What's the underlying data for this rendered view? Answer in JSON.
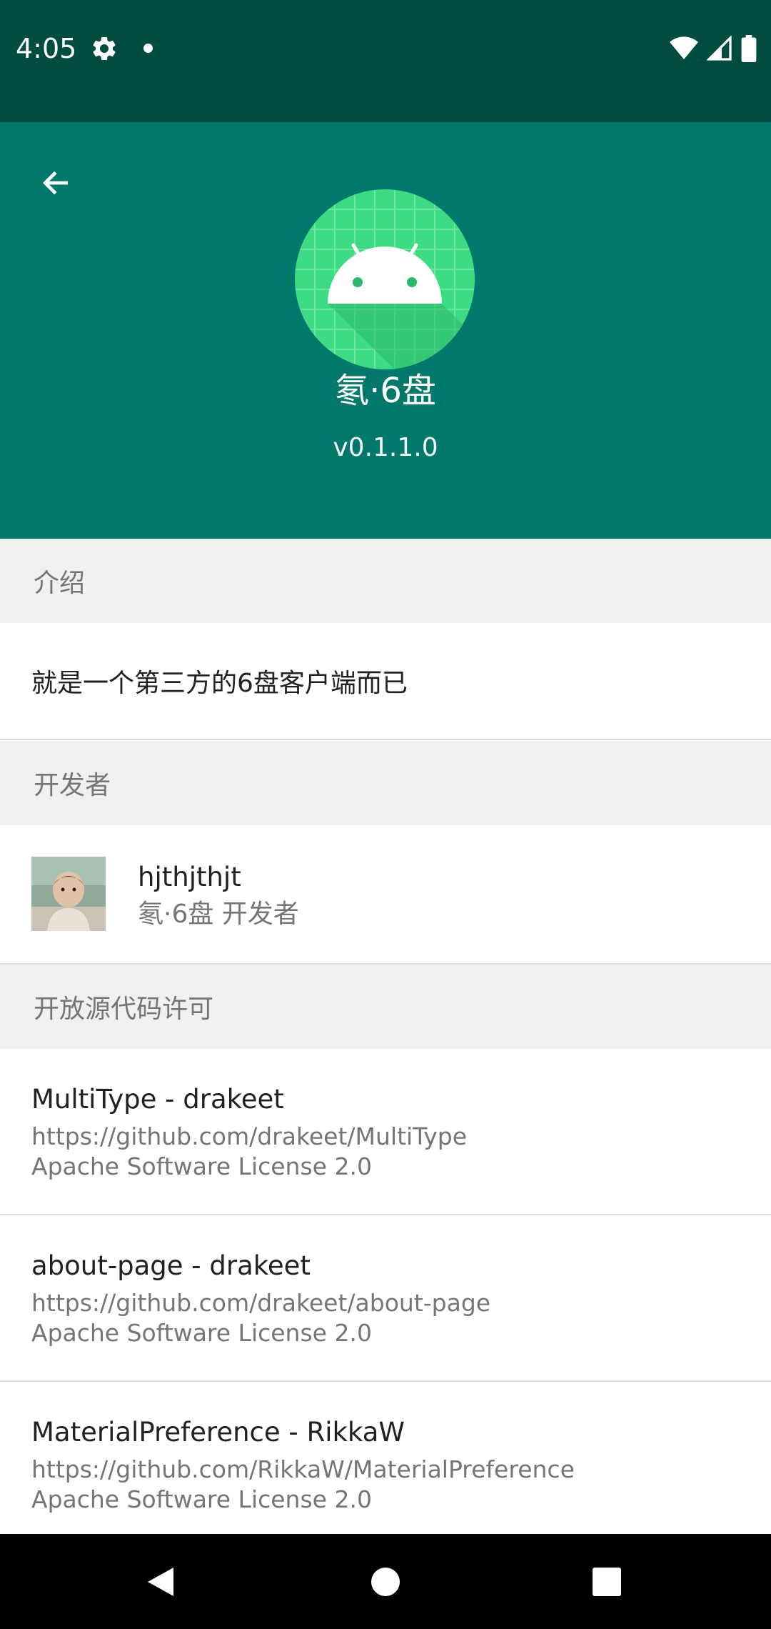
{
  "status_bar": {
    "time": "4:05",
    "icons": [
      "gear-icon",
      "notification-dot-icon",
      "wifi-icon",
      "cell-signal-icon",
      "battery-icon"
    ]
  },
  "header": {
    "back_icon": "arrow-left-icon",
    "app_icon": "android-robot-icon",
    "app_name": "氡·6盘",
    "version": "v0.1.1.0",
    "background_color": "#00796b",
    "status_bar_color": "#004d40",
    "icon_color": "#3ddc84"
  },
  "sections": {
    "intro": {
      "title": "介绍",
      "text": "就是一个第三方的6盘客户端而已"
    },
    "developer": {
      "title": "开发者",
      "name": "hjthjthjt",
      "role": "氡·6盘 开发者"
    },
    "licenses": {
      "title": "开放源代码许可",
      "items": [
        {
          "title": "MultiType - drakeet",
          "url": "https://github.com/drakeet/MultiType",
          "license": "Apache Software License 2.0"
        },
        {
          "title": "about-page - drakeet",
          "url": "https://github.com/drakeet/about-page",
          "license": "Apache Software License 2.0"
        },
        {
          "title": "MaterialPreference - RikkaW",
          "url": "https://github.com/RikkaW/MaterialPreference",
          "license": "Apache Software License 2.0"
        }
      ]
    }
  },
  "nav_bar": {
    "icons": [
      "back-triangle-icon",
      "home-circle-icon",
      "recents-square-icon"
    ]
  }
}
